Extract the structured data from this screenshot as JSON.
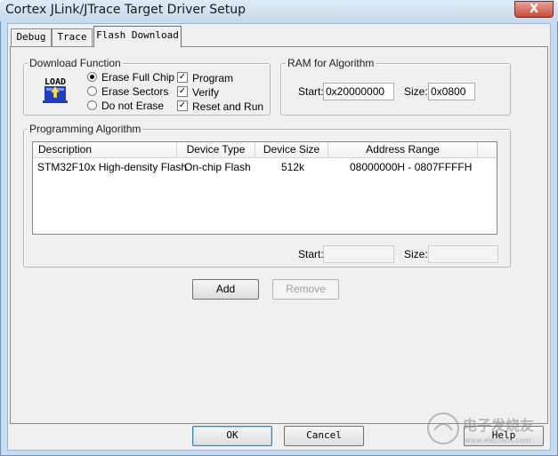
{
  "window": {
    "title": "Cortex JLink/JTrace Target Driver Setup",
    "close_glyph": "X"
  },
  "tabs": [
    {
      "label": "Debug"
    },
    {
      "label": "Trace"
    },
    {
      "label": "Flash Download"
    }
  ],
  "download_function": {
    "legend": "Download Function",
    "icon_text": "LOAD",
    "radios": [
      {
        "label": "Erase Full Chip",
        "selected": true
      },
      {
        "label": "Erase Sectors",
        "selected": false
      },
      {
        "label": "Do not Erase",
        "selected": false
      }
    ],
    "checks": [
      {
        "label": "Program",
        "checked": true
      },
      {
        "label": "Verify",
        "checked": true
      },
      {
        "label": "Reset and Run",
        "checked": true
      }
    ]
  },
  "ram": {
    "legend": "RAM for Algorithm",
    "start_label": "Start:",
    "start_value": "0x20000000",
    "size_label": "Size:",
    "size_value": "0x0800"
  },
  "programming_algorithm": {
    "legend": "Programming Algorithm",
    "columns": [
      "Description",
      "Device Type",
      "Device Size",
      "Address Range"
    ],
    "rows": [
      [
        "STM32F10x High-density Flash",
        "On-chip Flash",
        "512k",
        "08000000H - 0807FFFFH"
      ]
    ],
    "start_label": "Start:",
    "start_value": "",
    "size_label": "Size:",
    "size_value": ""
  },
  "buttons": {
    "add": "Add",
    "remove": "Remove",
    "ok": "OK",
    "cancel": "Cancel",
    "help": "Help"
  },
  "watermark": {
    "text": "电子发烧友",
    "url": "www.elecfans.com"
  },
  "colors": {
    "selected_tab_border": "#6e6e6e",
    "close_button": "#c84a3a",
    "icon_blue": "#1f3fbf"
  }
}
